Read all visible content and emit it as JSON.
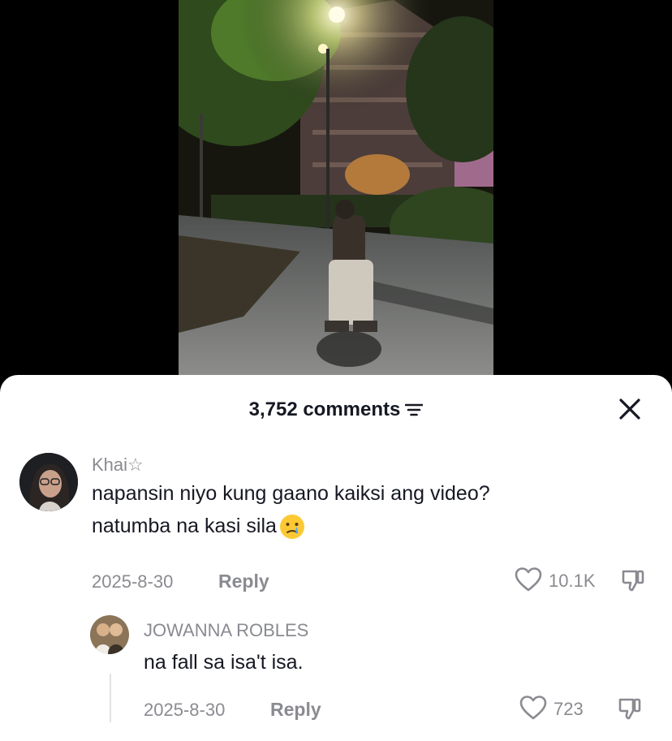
{
  "video": {
    "description_icon": "video-thumbnail"
  },
  "sheet": {
    "comments_count": "3,752 comments",
    "filter_icon": "filter-lines-icon",
    "close_icon": "close-icon"
  },
  "comments": [
    {
      "username": "Khai☆",
      "text_line1": "napansin niyo kung gaano kaiksi ang video?",
      "text_line2": "natumba na kasi sila",
      "emoji": "crying-face-emoji",
      "date": "2025-8-30",
      "reply_label": "Reply",
      "likes": "10.1K"
    }
  ],
  "replies": [
    {
      "username": "JOWANNA ROBLES",
      "text": "na fall sa isa't isa.",
      "date": "2025-8-30",
      "reply_label": "Reply",
      "likes": "723"
    }
  ],
  "colors": {
    "primary_text": "#161823",
    "secondary_text": "#8a8b91",
    "background": "#ffffff"
  }
}
